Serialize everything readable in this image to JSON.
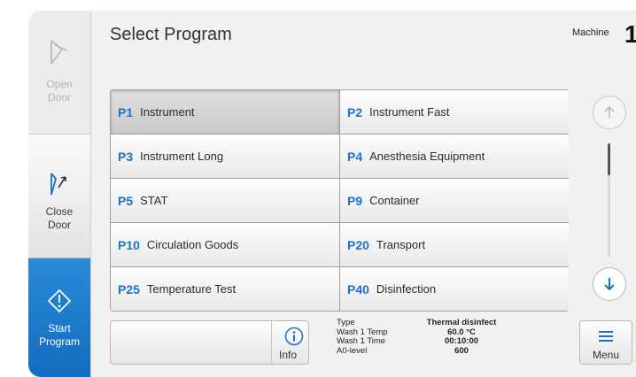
{
  "header": {
    "title": "Select Program",
    "machine_label": "Machine",
    "machine_number": "1"
  },
  "sidebar": {
    "open_door": {
      "label": "Open\nDoor",
      "icon": "open-door-icon"
    },
    "close_door": {
      "label": "Close\nDoor",
      "icon": "close-door-icon"
    },
    "start_program": {
      "label": "Start\nProgram",
      "icon": "start-diamond-icon"
    }
  },
  "programs": [
    {
      "code": "P1",
      "name": "Instrument"
    },
    {
      "code": "P2",
      "name": "Instrument Fast"
    },
    {
      "code": "P3",
      "name": "Instrument Long"
    },
    {
      "code": "P4",
      "name": "Anesthesia Equipment"
    },
    {
      "code": "P5",
      "name": "STAT"
    },
    {
      "code": "P9",
      "name": "Container"
    },
    {
      "code": "P10",
      "name": "Circulation Goods"
    },
    {
      "code": "P20",
      "name": "Transport"
    },
    {
      "code": "P25",
      "name": "Temperature Test"
    },
    {
      "code": "P40",
      "name": "Disinfection"
    }
  ],
  "selected_program": "P1",
  "info_button": {
    "label": "Info",
    "icon": "info-icon"
  },
  "details": [
    {
      "label": "Type",
      "value": "Thermal disinfect"
    },
    {
      "label": "Wash 1 Temp",
      "value": "60.0  °C"
    },
    {
      "label": "Wash 1 Time",
      "value": "00:10:00"
    },
    {
      "label": "A0-level",
      "value": "600"
    }
  ],
  "menu_button": {
    "label": "Menu",
    "icon": "menu-icon"
  },
  "scroll": {
    "position": 0
  },
  "colors": {
    "accent": "#1a73c8",
    "start_button": "#1b78cc"
  }
}
